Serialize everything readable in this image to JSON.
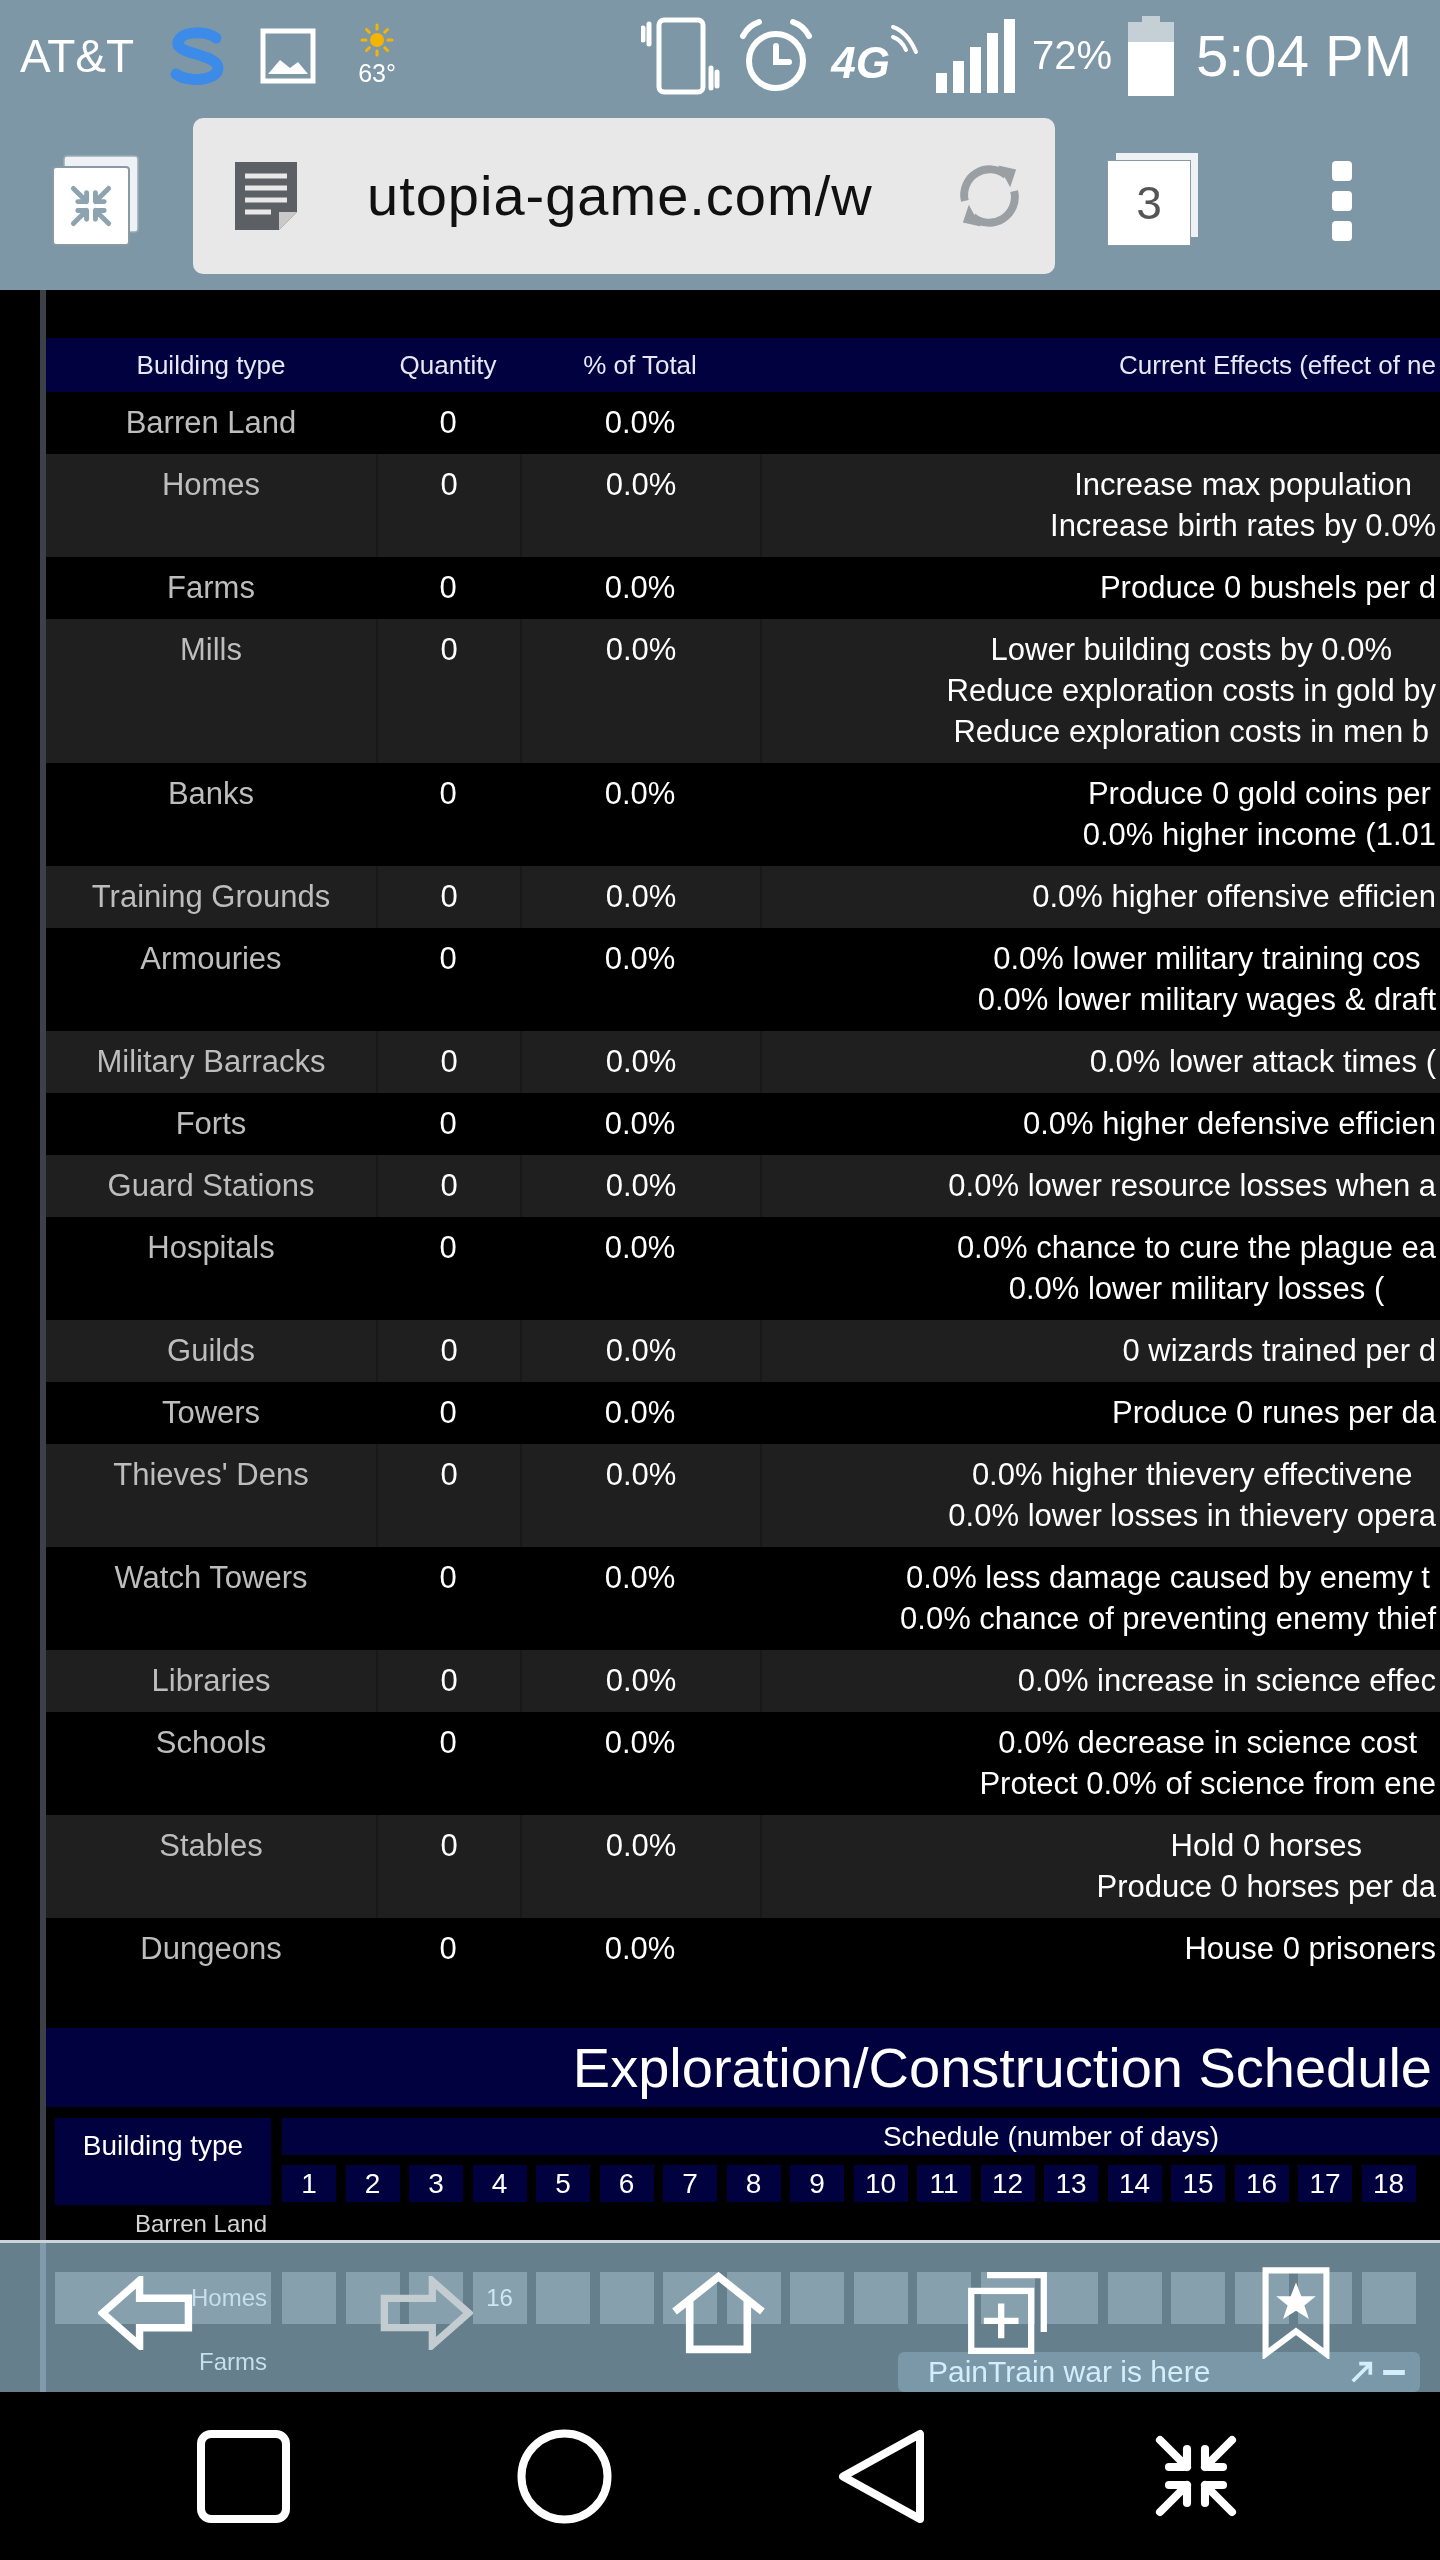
{
  "status_bar": {
    "carrier": "AT&T",
    "temperature": "63°",
    "network": "4G",
    "battery": "72%",
    "time": "5:04 PM"
  },
  "browser": {
    "url": "utopia-game.com/w",
    "tab_count": "3"
  },
  "buildings_table": {
    "columns": [
      "Building type",
      "Quantity",
      "% of Total",
      "Current Effects (effect of ne"
    ],
    "rows": [
      {
        "building": "Barren Land",
        "quantity": "0",
        "percent": "0.0%"
      },
      {
        "building": "Homes",
        "quantity": "0",
        "percent": "0.0%",
        "effects": [
          "Increase max population",
          "Increase birth rates by 0.0%"
        ]
      },
      {
        "building": "Farms",
        "quantity": "0",
        "percent": "0.0%",
        "effects": [
          "Produce 0 bushels per d"
        ]
      },
      {
        "building": "Mills",
        "quantity": "0",
        "percent": "0.0%",
        "effects": [
          "Lower building costs by 0.0%",
          "Reduce exploration costs in gold by",
          "Reduce exploration costs in men b"
        ]
      },
      {
        "building": "Banks",
        "quantity": "0",
        "percent": "0.0%",
        "effects": [
          "Produce 0 gold coins per",
          "0.0% higher income (1.01"
        ]
      },
      {
        "building": "Training Grounds",
        "quantity": "0",
        "percent": "0.0%",
        "effects": [
          "0.0% higher offensive efficien"
        ]
      },
      {
        "building": "Armouries",
        "quantity": "0",
        "percent": "0.0%",
        "effects": [
          "0.0% lower military training cos",
          "0.0% lower military wages & draft"
        ]
      },
      {
        "building": "Military Barracks",
        "quantity": "0",
        "percent": "0.0%",
        "effects": [
          "0.0% lower attack times ("
        ]
      },
      {
        "building": "Forts",
        "quantity": "0",
        "percent": "0.0%",
        "effects": [
          "0.0% higher defensive efficien"
        ]
      },
      {
        "building": "Guard Stations",
        "quantity": "0",
        "percent": "0.0%",
        "effects": [
          "0.0% lower resource losses when a"
        ]
      },
      {
        "building": "Hospitals",
        "quantity": "0",
        "percent": "0.0%",
        "effects": [
          "0.0% chance to cure the plague ea",
          "0.0% lower military losses ("
        ]
      },
      {
        "building": "Guilds",
        "quantity": "0",
        "percent": "0.0%",
        "effects": [
          "0 wizards trained per d"
        ]
      },
      {
        "building": "Towers",
        "quantity": "0",
        "percent": "0.0%",
        "effects": [
          "Produce 0 runes per da"
        ]
      },
      {
        "building": "Thieves' Dens",
        "quantity": "0",
        "percent": "0.0%",
        "effects": [
          "0.0% higher thievery effectivene",
          "0.0% lower losses in thievery opera"
        ]
      },
      {
        "building": "Watch Towers",
        "quantity": "0",
        "percent": "0.0%",
        "effects": [
          "0.0% less damage caused by enemy t",
          "0.0% chance of preventing enemy thief"
        ]
      },
      {
        "building": "Libraries",
        "quantity": "0",
        "percent": "0.0%",
        "effects": [
          "0.0% increase in science effec"
        ]
      },
      {
        "building": "Schools",
        "quantity": "0",
        "percent": "0.0%",
        "effects": [
          "0.0% decrease in science cost",
          "Protect 0.0% of science from ene"
        ]
      },
      {
        "building": "Stables",
        "quantity": "0",
        "percent": "0.0%",
        "effects": [
          "Hold 0 horses",
          "Produce 0 horses per da"
        ]
      },
      {
        "building": "Dungeons",
        "quantity": "0",
        "percent": "0.0%",
        "effects": [
          "House 0 prisoners"
        ]
      }
    ]
  },
  "schedule": {
    "title": "Exploration/Construction Schedule",
    "building_header": "Building type",
    "schedule_header": "Schedule (number of days)",
    "days": [
      "1",
      "2",
      "3",
      "4",
      "5",
      "6",
      "7",
      "8",
      "9",
      "10",
      "11",
      "12",
      "13",
      "14",
      "15",
      "16",
      "17",
      "18"
    ],
    "rows": [
      {
        "building": "Barren Land"
      },
      {
        "building": "Homes",
        "cells": [
          null,
          null,
          null,
          "16"
        ]
      },
      {
        "building": "Farms"
      }
    ]
  },
  "notification": {
    "text": "PainTrain war is here"
  },
  "bottom_toolbar": {
    "buttons": [
      {
        "kind": "back",
        "disabled": false
      },
      {
        "kind": "forward",
        "disabled": true
      },
      {
        "kind": "home",
        "disabled": false
      },
      {
        "kind": "new_tab",
        "disabled": false
      },
      {
        "kind": "bookmarks",
        "disabled": false
      }
    ]
  }
}
